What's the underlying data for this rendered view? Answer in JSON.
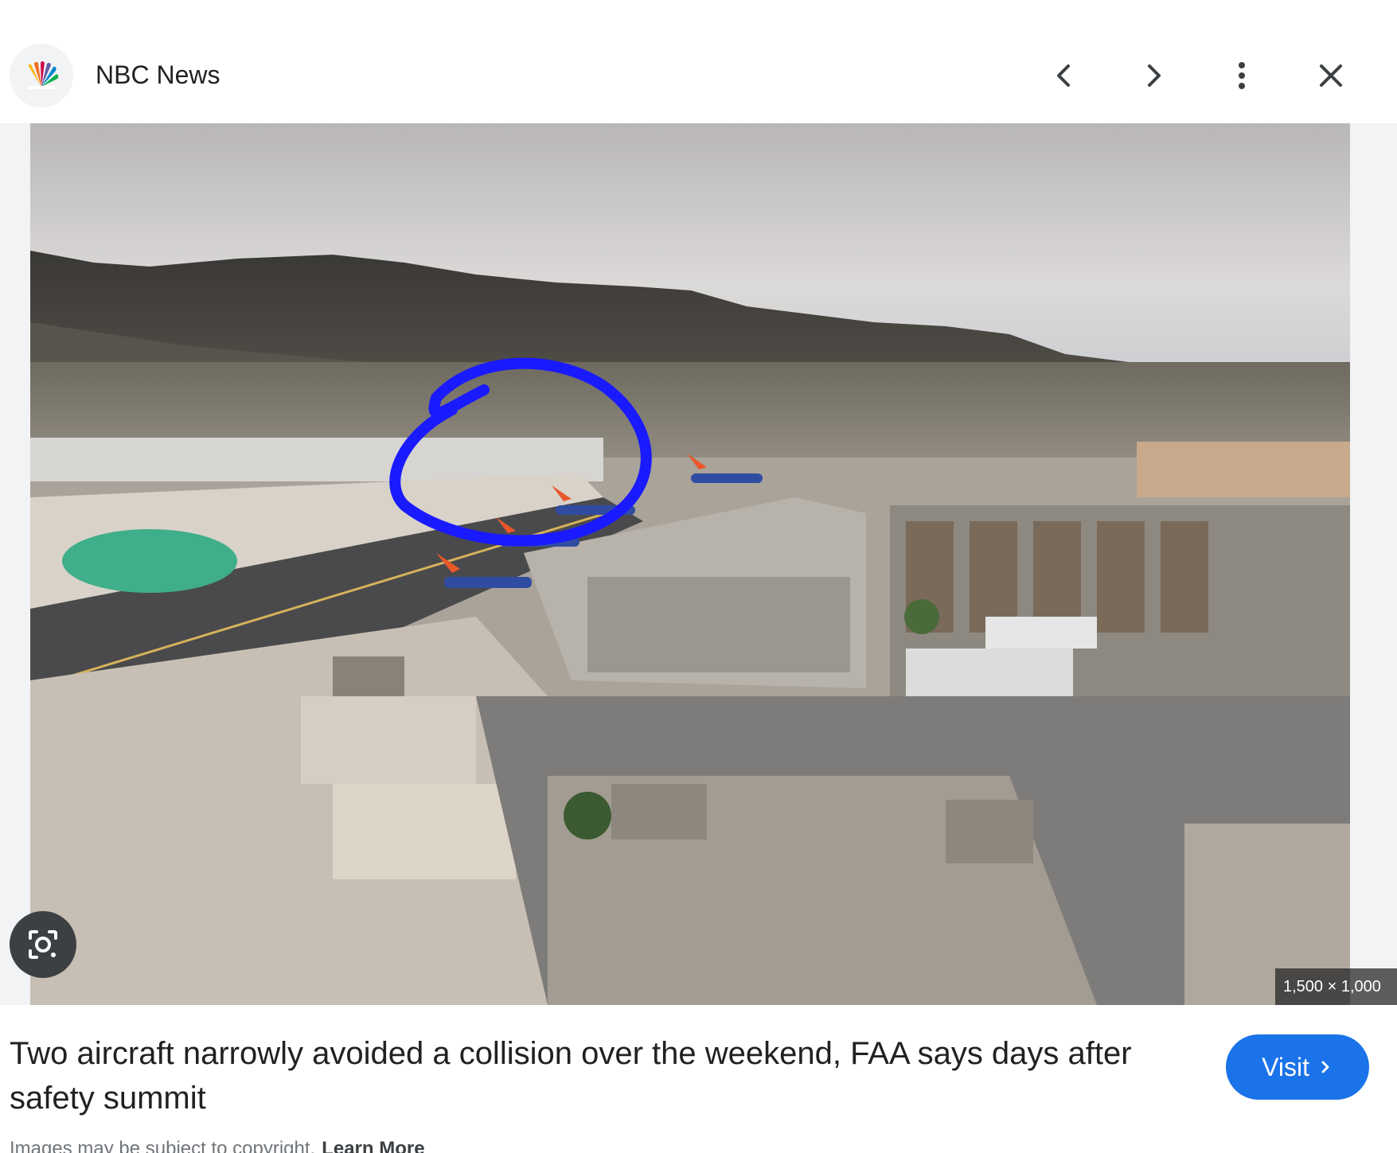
{
  "header": {
    "source_name": "NBC News",
    "logo_icon": "nbc-peacock-icon",
    "buttons": [
      {
        "name": "previous",
        "icon": "chevron-left-icon"
      },
      {
        "name": "next",
        "icon": "chevron-right-icon"
      },
      {
        "name": "more",
        "icon": "more-vert-icon"
      },
      {
        "name": "close",
        "icon": "close-icon"
      }
    ]
  },
  "image": {
    "description_icon": "airport-aerial-photo",
    "dimensions_label": "1,500 × 1,000",
    "annotation_color": "#1a1aff",
    "lens_icon": "google-lens-icon"
  },
  "caption": {
    "title": "Two aircraft narrowly avoided a collision over the weekend, FAA says days after safety summit",
    "visit_label": "Visit",
    "visit_icon": "chevron-right-icon"
  },
  "footer": {
    "copyright_text": "Images may be subject to copyright.",
    "learn_more_label": "Learn More"
  },
  "colors": {
    "accent": "#1a73e8",
    "text": "#202124",
    "muted": "#70757a"
  }
}
